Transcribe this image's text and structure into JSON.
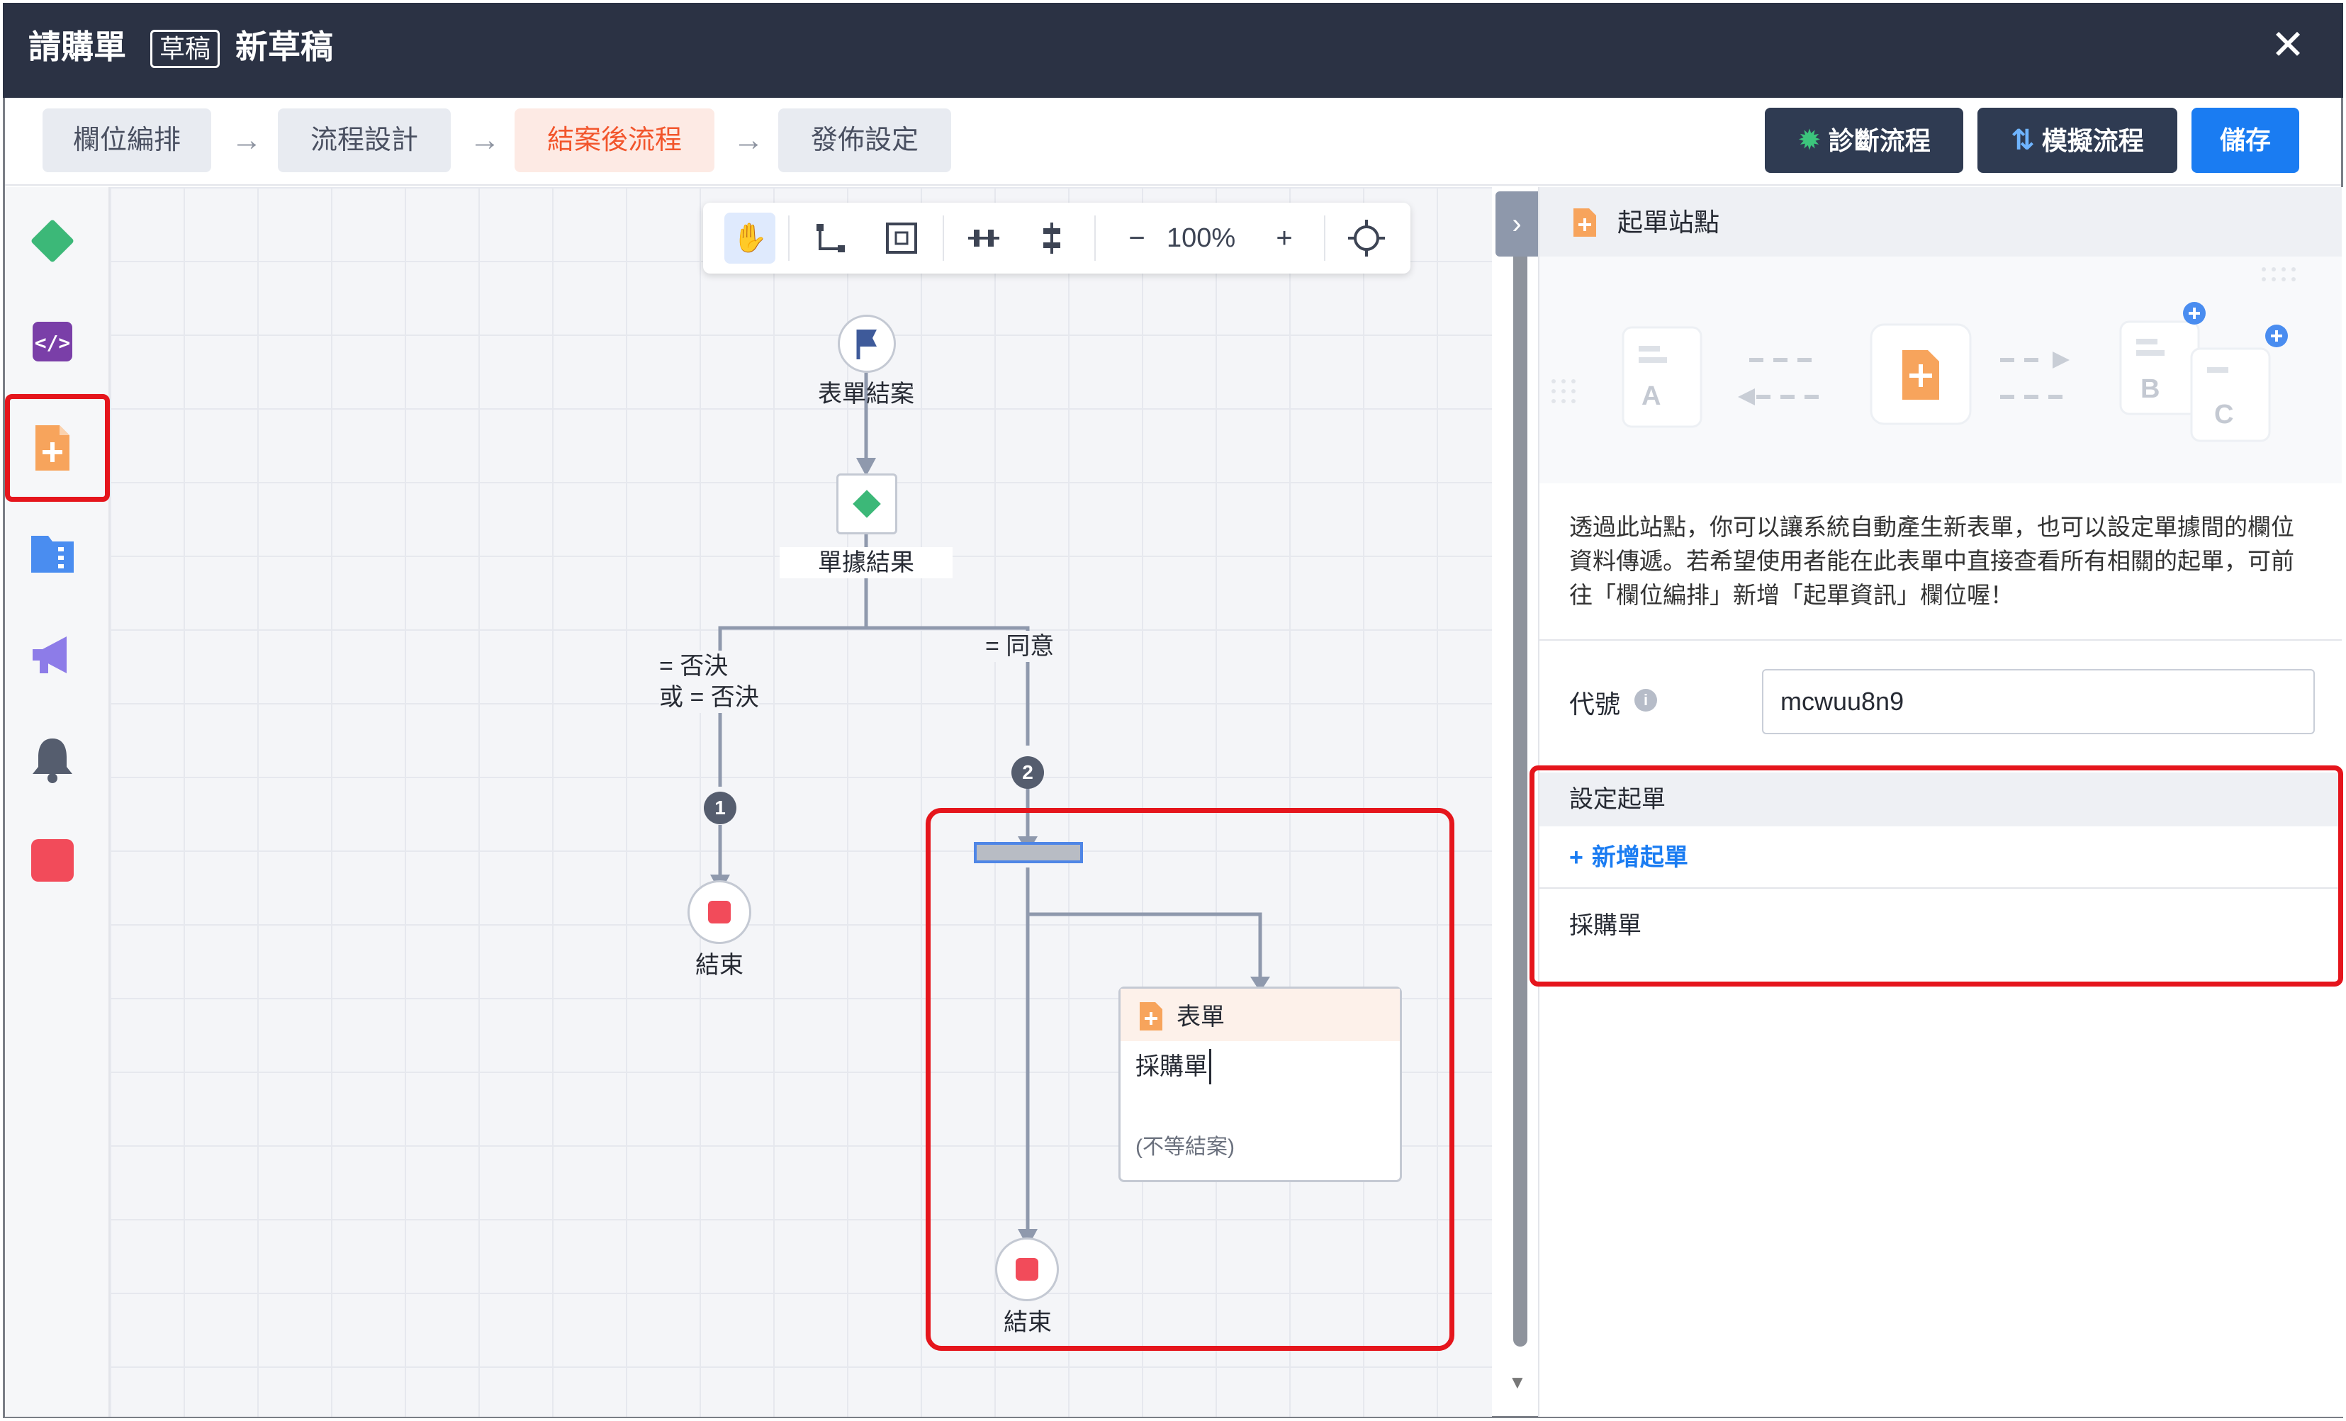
{
  "window": {
    "title": "請購單",
    "status_tag": "草稿",
    "draft_name": "新草稿",
    "close_label": "✕"
  },
  "steps": [
    {
      "label": "欄位編排"
    },
    {
      "label": "流程設計"
    },
    {
      "label": "結案後流程",
      "active": true
    },
    {
      "label": "發佈設定"
    }
  ],
  "actions": {
    "diagnose": "診斷流程",
    "simulate": "模擬流程",
    "save": "儲存"
  },
  "palette": [
    {
      "icon": "diamond-icon",
      "color": "#3cb878"
    },
    {
      "icon": "code-icon",
      "color": "#7a3fa8"
    },
    {
      "icon": "form-add-icon",
      "color": "#f7a45c"
    },
    {
      "icon": "folder-icon",
      "color": "#4a8df0"
    },
    {
      "icon": "megaphone-icon",
      "color": "#8d7ce8"
    },
    {
      "icon": "bell-icon",
      "color": "#555d6e"
    },
    {
      "icon": "stop-icon",
      "color": "#f24b5a"
    }
  ],
  "canvas_toolbar": {
    "zoom": "100%",
    "minus": "−",
    "plus": "+"
  },
  "flow": {
    "start_label": "表單結案",
    "decision_label": "單據結果",
    "branch_reject": [
      "= 否決",
      "或 = 否決"
    ],
    "branch_approve": "= 同意",
    "badge_1": "1",
    "badge_2": "2",
    "end_label": "結束",
    "form_node": {
      "header": "表單",
      "name": "採購單",
      "note": "(不等結案)"
    }
  },
  "panel": {
    "title": "起單站點",
    "description": "透過此站點，你可以讓系統自動產生新表單，也可以設定單據間的欄位資料傳遞。若希望使用者能在此表單中直接查看所有相關的起單，可前往「欄位編排」新增「起單資訊」欄位喔！",
    "code_label": "代號",
    "code_value": "mcwuu8n9",
    "section_title": "設定起單",
    "add_label": "新增起單",
    "items": [
      "採購單"
    ],
    "illustration_letters": [
      "A",
      "B",
      "C"
    ]
  },
  "colors": {
    "titlebar": "#2b3244",
    "primary": "#1a7cf2",
    "active_step": "#f2552c",
    "highlight": "#e5151c",
    "stop": "#f24b5a"
  }
}
